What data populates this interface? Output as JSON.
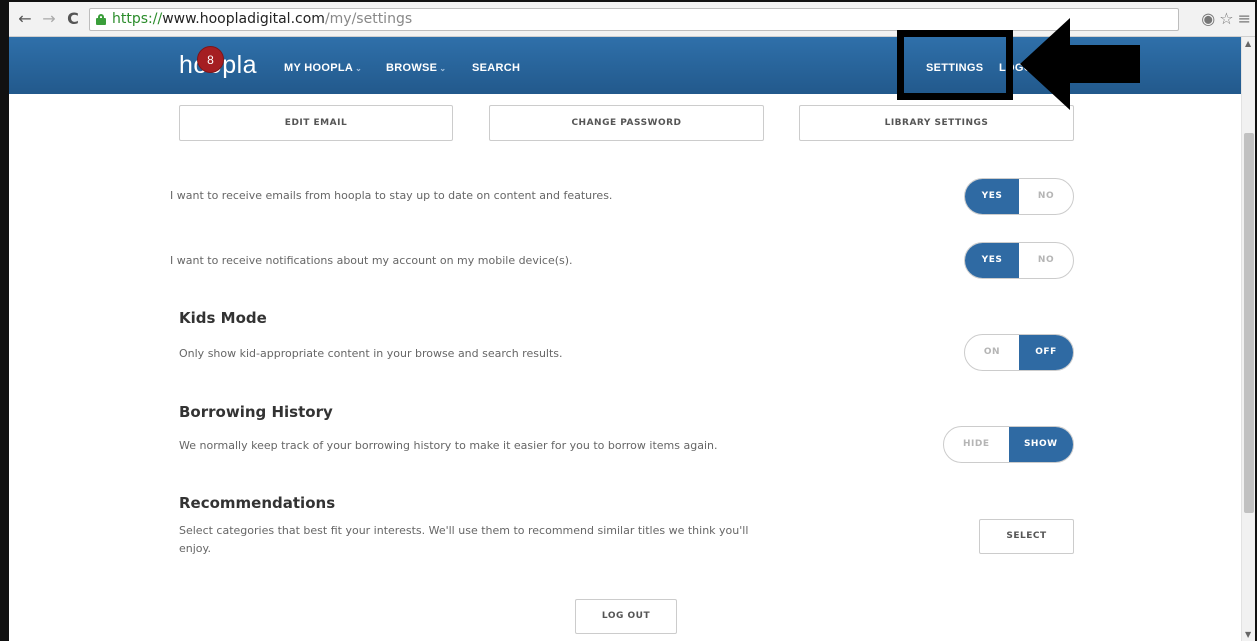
{
  "browser": {
    "back_glyph": "←",
    "forward_glyph": "→",
    "reload_glyph": "C",
    "url_secure": "https://",
    "url_host": "www.hoopladigital.com",
    "url_path": "/my/settings",
    "location_icon": "◉",
    "star_icon": "☆",
    "menu_icon": "≡"
  },
  "site": {
    "logo": "hoopla",
    "badge_count": "8",
    "nav": {
      "my_hoopla": "MY HOOPLA",
      "browse": "BROWSE",
      "search": "SEARCH",
      "settings": "SETTINGS",
      "logout_partial": "LOGO"
    },
    "header_color": "#2e6da4"
  },
  "tabs": {
    "edit_email": "EDIT EMAIL",
    "change_password": "CHANGE PASSWORD",
    "library_settings": "LIBRARY SETTINGS"
  },
  "prefs": {
    "emails": {
      "text": "I want to receive emails from hoopla to stay up to date on content and features.",
      "on_label": "YES",
      "off_label": "NO",
      "selected": "YES"
    },
    "notifications": {
      "text": "I want to receive notifications about my account on my mobile device(s).",
      "on_label": "YES",
      "off_label": "NO",
      "selected": "YES"
    },
    "kids_mode": {
      "title": "Kids Mode",
      "desc": "Only show kid-appropriate content in your browse and search results.",
      "on_label": "ON",
      "off_label": "OFF",
      "selected": "OFF"
    },
    "borrowing_history": {
      "title": "Borrowing History",
      "desc": "We normally keep track of your borrowing history to make it easier for you to borrow items again.",
      "hide_label": "HIDE",
      "show_label": "SHOW",
      "selected": "SHOW"
    },
    "recommendations": {
      "title": "Recommendations",
      "desc_line1": "Select categories that best fit your interests. We'll use them to recommend similar titles we think you'll",
      "desc_line2": "enjoy.",
      "button": "SELECT"
    }
  },
  "logout_button": "LOG OUT",
  "accent_color": "#2f6aa3"
}
